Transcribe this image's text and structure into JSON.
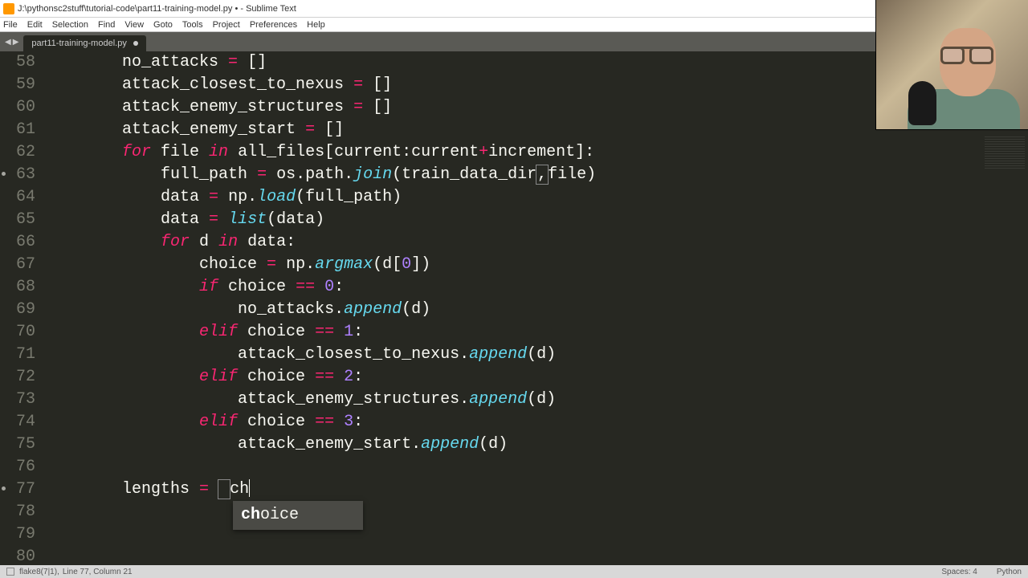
{
  "window": {
    "title": "J:\\pythonsc2stuff\\tutorial-code\\part11-training-model.py • - Sublime Text"
  },
  "menu": {
    "items": [
      "File",
      "Edit",
      "Selection",
      "Find",
      "View",
      "Goto",
      "Tools",
      "Project",
      "Preferences",
      "Help"
    ]
  },
  "tab": {
    "label": "part11-training-model.py"
  },
  "lines": {
    "start": 58,
    "end": 80,
    "modified": [
      63,
      77
    ]
  },
  "code": {
    "58": {
      "indent": "        ",
      "tokens": [
        [
          "pl",
          "no_attacks "
        ],
        [
          "op",
          "="
        ],
        [
          "pl",
          " []"
        ]
      ]
    },
    "59": {
      "indent": "        ",
      "tokens": [
        [
          "pl",
          "attack_closest_to_nexus "
        ],
        [
          "op",
          "="
        ],
        [
          "pl",
          " []"
        ]
      ]
    },
    "60": {
      "indent": "        ",
      "tokens": [
        [
          "pl",
          "attack_enemy_structures "
        ],
        [
          "op",
          "="
        ],
        [
          "pl",
          " []"
        ]
      ]
    },
    "61": {
      "indent": "        ",
      "tokens": [
        [
          "pl",
          "attack_enemy_start "
        ],
        [
          "op",
          "="
        ],
        [
          "pl",
          " []"
        ]
      ]
    },
    "62": {
      "indent": "        ",
      "tokens": [
        [
          "kw",
          "for"
        ],
        [
          "pl",
          " file "
        ],
        [
          "kw",
          "in"
        ],
        [
          "pl",
          " all_files[current:current"
        ],
        [
          "op",
          "+"
        ],
        [
          "pl",
          "increment]:"
        ]
      ]
    },
    "63": {
      "indent": "            ",
      "tokens": [
        [
          "pl",
          "full_path "
        ],
        [
          "op",
          "="
        ],
        [
          "pl",
          " os.path."
        ],
        [
          "fn",
          "join"
        ],
        [
          "pl",
          "(train_data_dir"
        ],
        [
          "bracket-hl",
          ","
        ],
        [
          "pl",
          "file)"
        ]
      ]
    },
    "64": {
      "indent": "            ",
      "tokens": [
        [
          "pl",
          "data "
        ],
        [
          "op",
          "="
        ],
        [
          "pl",
          " np."
        ],
        [
          "fn",
          "load"
        ],
        [
          "pl",
          "(full_path)"
        ]
      ]
    },
    "65": {
      "indent": "            ",
      "tokens": [
        [
          "pl",
          "data "
        ],
        [
          "op",
          "="
        ],
        [
          "pl",
          " "
        ],
        [
          "builtin",
          "list"
        ],
        [
          "pl",
          "(data)"
        ]
      ]
    },
    "66": {
      "indent": "            ",
      "tokens": [
        [
          "kw",
          "for"
        ],
        [
          "pl",
          " d "
        ],
        [
          "kw",
          "in"
        ],
        [
          "pl",
          " data:"
        ]
      ]
    },
    "67": {
      "indent": "                ",
      "tokens": [
        [
          "pl",
          "choice "
        ],
        [
          "op",
          "="
        ],
        [
          "pl",
          " np."
        ],
        [
          "fn",
          "argmax"
        ],
        [
          "pl",
          "(d["
        ],
        [
          "num",
          "0"
        ],
        [
          "pl",
          "])"
        ]
      ]
    },
    "68": {
      "indent": "                ",
      "tokens": [
        [
          "kw",
          "if"
        ],
        [
          "pl",
          " choice "
        ],
        [
          "op",
          "=="
        ],
        [
          "pl",
          " "
        ],
        [
          "num",
          "0"
        ],
        [
          "pl",
          ":"
        ]
      ]
    },
    "69": {
      "indent": "                    ",
      "tokens": [
        [
          "pl",
          "no_attacks."
        ],
        [
          "fn",
          "append"
        ],
        [
          "pl",
          "(d)"
        ]
      ]
    },
    "70": {
      "indent": "                ",
      "tokens": [
        [
          "kw",
          "elif"
        ],
        [
          "pl",
          " choice "
        ],
        [
          "op",
          "=="
        ],
        [
          "pl",
          " "
        ],
        [
          "num",
          "1"
        ],
        [
          "pl",
          ":"
        ]
      ]
    },
    "71": {
      "indent": "                    ",
      "tokens": [
        [
          "pl",
          "attack_closest_to_nexus."
        ],
        [
          "fn",
          "append"
        ],
        [
          "pl",
          "(d)"
        ]
      ]
    },
    "72": {
      "indent": "                ",
      "tokens": [
        [
          "kw",
          "elif"
        ],
        [
          "pl",
          " choice "
        ],
        [
          "op",
          "=="
        ],
        [
          "pl",
          " "
        ],
        [
          "num",
          "2"
        ],
        [
          "pl",
          ":"
        ]
      ]
    },
    "73": {
      "indent": "                    ",
      "tokens": [
        [
          "pl",
          "attack_enemy_structures."
        ],
        [
          "fn",
          "append"
        ],
        [
          "pl",
          "(d)"
        ]
      ]
    },
    "74": {
      "indent": "                ",
      "tokens": [
        [
          "kw",
          "elif"
        ],
        [
          "pl",
          " choice "
        ],
        [
          "op",
          "=="
        ],
        [
          "pl",
          " "
        ],
        [
          "num",
          "3"
        ],
        [
          "pl",
          ":"
        ]
      ]
    },
    "75": {
      "indent": "                    ",
      "tokens": [
        [
          "pl",
          "attack_enemy_start."
        ],
        [
          "fn",
          "append"
        ],
        [
          "pl",
          "(d)"
        ]
      ]
    },
    "76": {
      "indent": "",
      "tokens": []
    },
    "77": {
      "indent": "        ",
      "tokens": [
        [
          "pl",
          "lengths "
        ],
        [
          "op",
          "="
        ],
        [
          "pl",
          " "
        ],
        [
          "bracket-hl",
          " "
        ],
        [
          "pl",
          "ch"
        ],
        [
          "cursor",
          ""
        ]
      ]
    },
    "78": {
      "indent": "",
      "tokens": []
    },
    "79": {
      "indent": "",
      "tokens": []
    },
    "80": {
      "indent": "",
      "tokens": []
    }
  },
  "autocomplete": {
    "match": "ch",
    "rest": "oice"
  },
  "status": {
    "linter": "flake8(7|1),",
    "position": "Line 77, Column 21",
    "indent": "Spaces: 4",
    "syntax": "Python"
  }
}
